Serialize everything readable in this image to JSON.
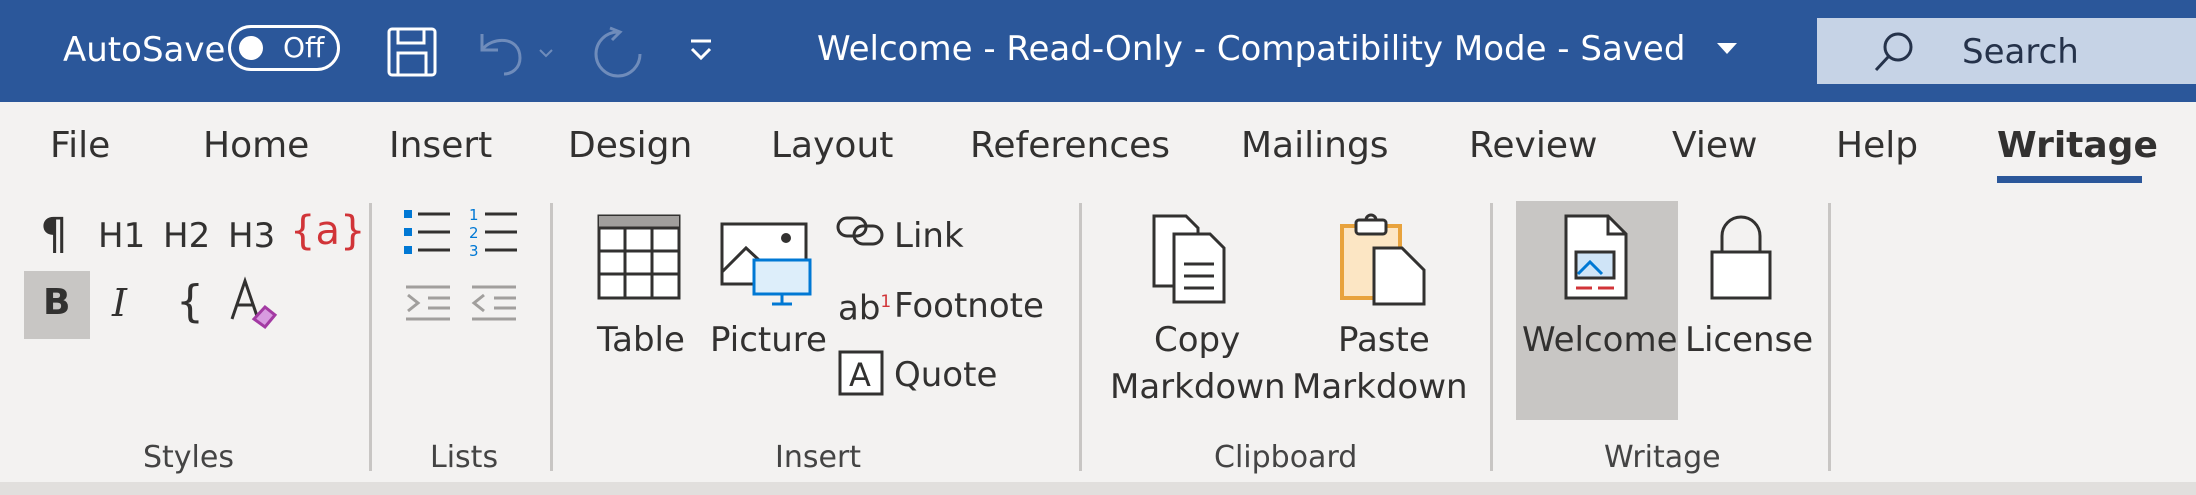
{
  "titlebar": {
    "autosave_label": "AutoSave",
    "autosave_state": "Off",
    "doc_title": "Welcome  -  Read-Only  -  Compatibility Mode  -  Saved",
    "search_label": "Search"
  },
  "tabs": [
    "File",
    "Home",
    "Insert",
    "Design",
    "Layout",
    "References",
    "Mailings",
    "Review",
    "View",
    "Help",
    "Writage"
  ],
  "active_tab": "Writage",
  "styles": {
    "paragraph_glyph": "¶",
    "h1": "H1",
    "h2": "H2",
    "h3": "H3",
    "variable": "{a}",
    "bold": "B",
    "italic": "I",
    "brace": "{",
    "label": "Styles"
  },
  "lists": {
    "label": "Lists"
  },
  "insert": {
    "table": "Table",
    "picture": "Picture",
    "link": "Link",
    "footnote": "Footnote",
    "quote": "Quote",
    "label": "Insert"
  },
  "clipboard": {
    "copy_line1": "Copy",
    "copy_line2": "Markdown",
    "paste_line1": "Paste",
    "paste_line2": "Markdown",
    "label": "Clipboard"
  },
  "writage": {
    "welcome": "Welcome",
    "license": "License",
    "label": "Writage"
  },
  "colors": {
    "titlebar": "#2b579a",
    "ribbon": "#f3f2f1",
    "search_box": "#c6d3e6",
    "variable_red": "#d13438",
    "list_blue": "#0078d4",
    "paste_orange": "#e8a33d"
  }
}
